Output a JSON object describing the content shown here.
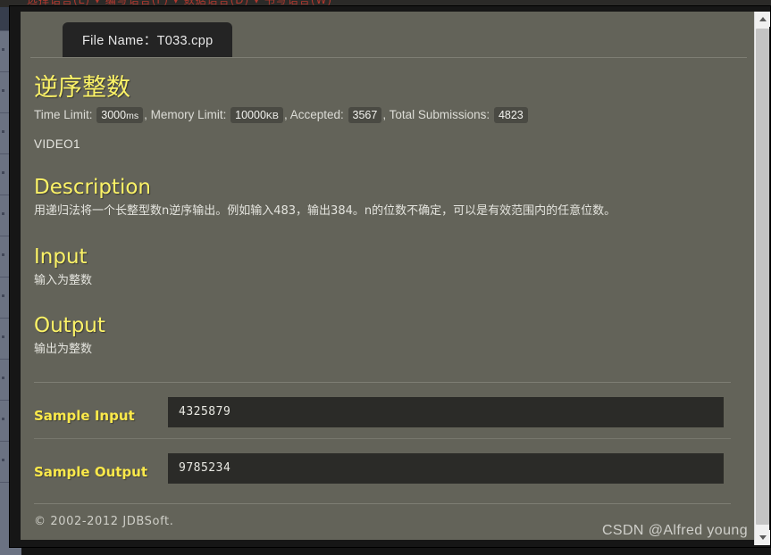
{
  "window": {
    "background_strip_text": "选择语言(L)  ▾   编写语言(F)  ▾   数据语言(D)  ▾   书写语言(W)"
  },
  "tab": {
    "label": "File Name：T033.cpp",
    "file_name": "T033.cpp"
  },
  "problem": {
    "title": "逆序整数",
    "video_tag": "VIDEO1",
    "stats": {
      "time_limit_label": "Time Limit:",
      "time_limit_value": "3000",
      "time_limit_unit": "ms",
      "memory_limit_label": "Memory Limit:",
      "memory_limit_value": "10000",
      "memory_limit_unit": "KB",
      "accepted_label": "Accepted:",
      "accepted_value": "3567",
      "total_submissions_label": "Total Submissions:",
      "total_submissions_value": "4823",
      "separator": ","
    },
    "sections": {
      "description_heading": "Description",
      "description_body": "用递归法将一个长整型数n逆序输出。例如输入483，输出384。n的位数不确定，可以是有效范围内的任意位数。",
      "input_heading": "Input",
      "input_body": "输入为整数",
      "output_heading": "Output",
      "output_body": "输出为整数"
    },
    "samples": {
      "sample_input_label": "Sample Input",
      "sample_input_value": "4325879",
      "sample_output_label": "Sample Output",
      "sample_output_value": "9785234"
    }
  },
  "footer": {
    "copyright": "© 2002-2012  JDBSoft."
  },
  "watermark": {
    "text": "CSDN @Alfred young"
  },
  "scrollbar": {
    "up_arrow": "scroll-up",
    "down_arrow": "scroll-down"
  },
  "colors": {
    "page_background": "#636359",
    "heading_yellow": "#fbf267",
    "sample_label_yellow": "#fbe94a",
    "code_box": "#2b2b28",
    "tab_background": "#242424",
    "frame": "#161616"
  }
}
